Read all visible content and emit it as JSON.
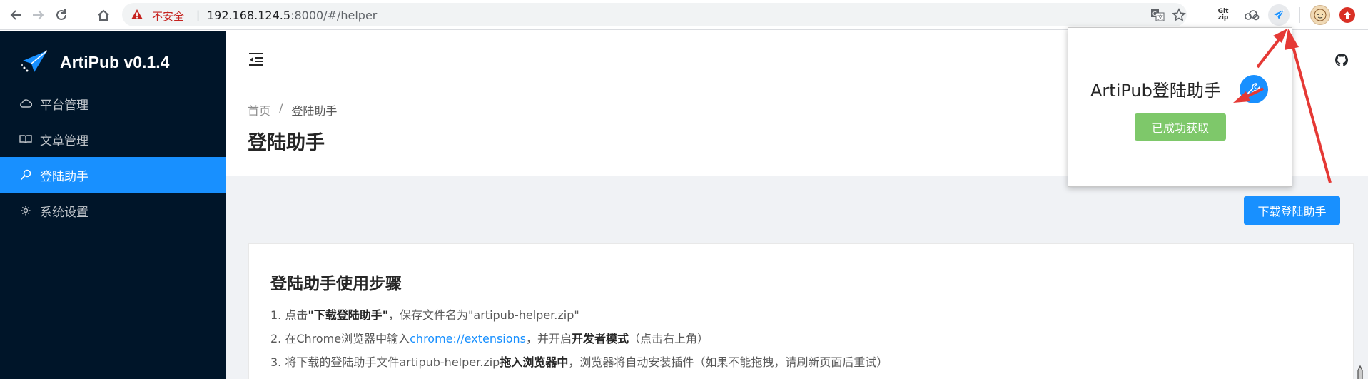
{
  "browser": {
    "insecure_label": "不安全",
    "separator": "|",
    "url_host": "192.168.124.5",
    "url_rest": ":8000/#/helper",
    "ext_git_zip_line1": "Git",
    "ext_git_zip_line2": "zip"
  },
  "sidebar": {
    "app_title": "ArtiPub v0.1.4",
    "items": [
      {
        "label": "平台管理",
        "icon": "cloud-icon"
      },
      {
        "label": "文章管理",
        "icon": "book-icon"
      },
      {
        "label": "登陆助手",
        "icon": "search-icon",
        "active": true
      },
      {
        "label": "系统设置",
        "icon": "gear-icon"
      }
    ]
  },
  "breadcrumb": {
    "home": "首页",
    "separator": "/",
    "current": "登陆助手"
  },
  "page": {
    "title": "登陆助手"
  },
  "content": {
    "download_button": "下载登陆助手",
    "card_title": "登陆助手使用步骤",
    "steps": [
      {
        "prefix": "1. 点击",
        "bold": "\"下载登陆助手\"",
        "suffix": "，保存文件名为\"artipub-helper.zip\""
      },
      {
        "prefix": "2. 在Chrome浏览器中输入",
        "link": "chrome://extensions",
        "middle": "，并开启",
        "bold": "开发者模式",
        "suffix": "（点击右上角）"
      },
      {
        "prefix": "3. 将下载的登陆助手文件artipub-helper.zip",
        "bold": "拖入浏览器中",
        "suffix": "，浏览器将自动安装插件（如果不能拖拽，请刷新页面后重试）"
      }
    ]
  },
  "popup": {
    "title": "ArtiPub登陆助手",
    "success_button": "已成功获取"
  },
  "colors": {
    "sidebar_bg": "#001529",
    "accent": "#1890ff",
    "success": "#7ec86a",
    "annotation_arrow": "#e53935"
  }
}
